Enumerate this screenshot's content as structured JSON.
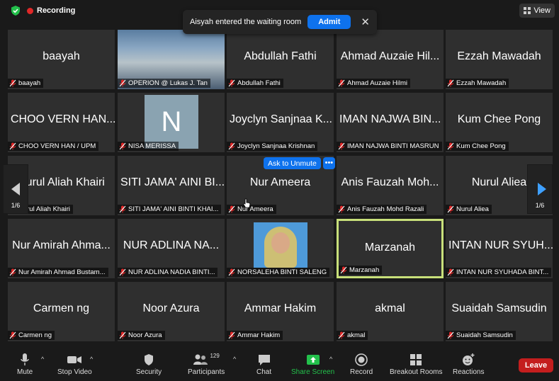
{
  "topbar": {
    "recording_label": "Recording",
    "view_label": "View"
  },
  "notification": {
    "text": "Aisyah entered the waiting room",
    "admit_label": "Admit"
  },
  "tiles": [
    {
      "name": "baayah",
      "label": "baayah"
    },
    {
      "name": "",
      "label": "OPERION @ Lukas J. Tan"
    },
    {
      "name": "Abdullah Fathi",
      "label": "Abdullah Fathi"
    },
    {
      "name": "Ahmad Auzaie Hil...",
      "label": "Ahmad Auzaie Hilmi"
    },
    {
      "name": "Ezzah Mawadah",
      "label": "Ezzah Mawadah"
    },
    {
      "name": "CHOO VERN HAN...",
      "label": "CHOO VERN HAN / UPM"
    },
    {
      "name": "N",
      "label": "NISA MERISSA"
    },
    {
      "name": "Joyclyn Sanjnaa K...",
      "label": "Joyclyn Sanjnaa Krishnan"
    },
    {
      "name": "IMAN NAJWA BIN...",
      "label": "IMAN NAJWA BINTI MASRUN"
    },
    {
      "name": "Kum Chee Pong",
      "label": "Kum Chee Pong"
    },
    {
      "name": "Nurul Aliah Khairi",
      "label": "Nurul Aliah Khairi"
    },
    {
      "name": "SITI JAMA' AINI BI...",
      "label": "SITI JAMA' AINI BINTI KHAI..."
    },
    {
      "name": "Nur Ameera",
      "label": "Nur Ameera"
    },
    {
      "name": "Anis Fauzah Moh...",
      "label": "Anis Fauzah Mohd Razali"
    },
    {
      "name": "Nurul Aliea",
      "label": "Nurul Aliea"
    },
    {
      "name": "Nur Amirah Ahma...",
      "label": "Nur Amirah Ahmad Bustam..."
    },
    {
      "name": "NUR ADLINA NA...",
      "label": "NUR ADLINA NADIA BINTI..."
    },
    {
      "name": "",
      "label": "NORSALEHA BINTI SALENG"
    },
    {
      "name": "Marzanah",
      "label": "Marzanah"
    },
    {
      "name": "INTAN NUR SYUH...",
      "label": "INTAN NUR SYUHADA BINT..."
    },
    {
      "name": "Carmen ng",
      "label": "Carmen ng"
    },
    {
      "name": "Noor Azura",
      "label": "Noor Azura"
    },
    {
      "name": "Ammar Hakim",
      "label": "Ammar Hakim"
    },
    {
      "name": "akmal",
      "label": "akmal"
    },
    {
      "name": "Suaidah Samsudin",
      "label": "Suaidah Samsudin"
    }
  ],
  "hover": {
    "ask_to_unmute": "Ask to Unmute",
    "more": "•••"
  },
  "pager": {
    "left": "1/6",
    "right": "1/6"
  },
  "toolbar": {
    "mute": "Mute",
    "stop_video": "Stop Video",
    "security": "Security",
    "participants": "Participants",
    "participants_count": "129",
    "chat": "Chat",
    "share_screen": "Share Screen",
    "record": "Record",
    "breakout_rooms": "Breakout Rooms",
    "reactions": "Reactions",
    "leave": "Leave"
  },
  "colors": {
    "accent_blue": "#0e72ed",
    "share_green": "#23c04b",
    "leave_red": "#c41e1e",
    "active_border": "#c8e07a"
  }
}
